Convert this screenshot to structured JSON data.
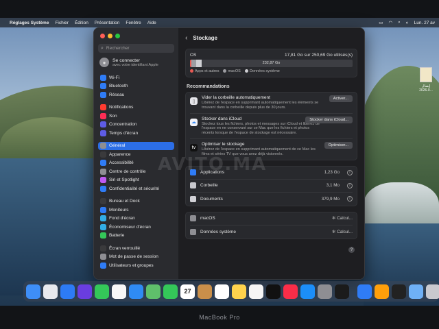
{
  "menubar": {
    "app": "Réglages Système",
    "items": [
      "Fichier",
      "Édition",
      "Présentation",
      "Fenêtre",
      "Aide"
    ],
    "datetime": "Lun. 27 av"
  },
  "desktop": {
    "file_label_1": "إيصال",
    "file_label_2": "2026-0..."
  },
  "sidebar": {
    "search_placeholder": "Rechercher",
    "account": {
      "title": "Se connecter",
      "subtitle": "avec votre identifiant Apple"
    },
    "groups": [
      [
        {
          "label": "Wi-Fi",
          "icon": "wifi-icon",
          "color": "#2f7cf6"
        },
        {
          "label": "Bluetooth",
          "icon": "bluetooth-icon",
          "color": "#2f7cf6"
        },
        {
          "label": "Réseau",
          "icon": "globe-icon",
          "color": "#2f7cf6"
        }
      ],
      [
        {
          "label": "Notifications",
          "icon": "bell-icon",
          "color": "#ff3b30"
        },
        {
          "label": "Son",
          "icon": "speaker-icon",
          "color": "#ff2d55"
        },
        {
          "label": "Concentration",
          "icon": "moon-icon",
          "color": "#5e5ce6"
        },
        {
          "label": "Temps d'écran",
          "icon": "hourglass-icon",
          "color": "#5e5ce6"
        }
      ],
      [
        {
          "label": "Général",
          "icon": "gear-icon",
          "color": "#8e8e93",
          "active": true
        },
        {
          "label": "Apparence",
          "icon": "appearance-icon",
          "color": "#3a3a3c"
        },
        {
          "label": "Accessibilité",
          "icon": "accessibility-icon",
          "color": "#2f7cf6"
        },
        {
          "label": "Centre de contrôle",
          "icon": "control-center-icon",
          "color": "#8e8e93"
        },
        {
          "label": "Siri et Spotlight",
          "icon": "siri-icon",
          "color": "#bf5af2"
        },
        {
          "label": "Confidentialité et sécurité",
          "icon": "hand-icon",
          "color": "#2f7cf6"
        }
      ],
      [
        {
          "label": "Bureau et Dock",
          "icon": "dock-icon",
          "color": "#3a3a3c"
        },
        {
          "label": "Moniteurs",
          "icon": "display-icon",
          "color": "#2f7cf6"
        },
        {
          "label": "Fond d'écran",
          "icon": "wallpaper-icon",
          "color": "#32ade6"
        },
        {
          "label": "Économiseur d'écran",
          "icon": "screensaver-icon",
          "color": "#32ade6"
        },
        {
          "label": "Batterie",
          "icon": "battery-icon",
          "color": "#34c759"
        }
      ],
      [
        {
          "label": "Écran verrouillé",
          "icon": "lock-screen-icon",
          "color": "#3a3a3c"
        },
        {
          "label": "Mot de passe de session",
          "icon": "lock-icon",
          "color": "#8e8e93"
        },
        {
          "label": "Utilisateurs et groupes",
          "icon": "users-icon",
          "color": "#2f7cf6"
        }
      ]
    ]
  },
  "content": {
    "title": "Stockage",
    "disk": {
      "name": "OS",
      "usage": "17,81 Go sur 250,69 Go utilisés(s)",
      "free": "232,87 Go",
      "used_fraction": 0.071,
      "segments": {
        "apps": 0.01,
        "macos": 0.03,
        "system": 0.031
      },
      "legend": [
        "Apps et autres",
        "macOS",
        "Données système"
      ],
      "colors": {
        "apps": "#e85a54",
        "macos": "#9d9da2",
        "system": "#cfcfd3"
      }
    },
    "recommendations_title": "Recommandations",
    "recommendations": [
      {
        "title": "Vider la corbeille automatiquement",
        "desc": "Libérez de l'espace en supprimant automatiquement les éléments se trouvant dans la corbeille depuis plus de 30 jours.",
        "button": "Activer...",
        "icon": "trash-icon"
      },
      {
        "title": "Stocker dans iCloud",
        "desc": "Stockez tous les fichiers, photos et messages sur iCloud et libérez de l'espace en ne conservant sur ce Mac que les fichiers et photos récents lorsque de l'espace de stockage est nécessaire.",
        "button": "Stocker dans iCloud...",
        "icon": "icloud-icon"
      },
      {
        "title": "Optimiser le stockage",
        "desc": "Libérez de l'espace en supprimant automatiquement de ce Mac les films et séries TV que vous avez déjà visionnés.",
        "button": "Optimiser...",
        "icon": "appletv-icon"
      }
    ],
    "categories": [
      {
        "label": "Applications",
        "value": "1,23 Go"
      },
      {
        "label": "Corbeille",
        "value": "3,1 Mo"
      },
      {
        "label": "Documents",
        "value": "379,9 Mo"
      }
    ],
    "system": [
      {
        "label": "macOS",
        "value": "Calcul..."
      },
      {
        "label": "Données système",
        "value": "Calcul..."
      }
    ]
  },
  "watermark": "AVITO.MA",
  "dock": [
    {
      "name": "finder-icon",
      "color": "#3e8ef7"
    },
    {
      "name": "launchpad-icon",
      "color": "#e9e9ee"
    },
    {
      "name": "safari-icon",
      "color": "#2d7bf5"
    },
    {
      "name": "siri-app-icon",
      "color": "#6a3de0"
    },
    {
      "name": "messages-icon",
      "color": "#34c759"
    },
    {
      "name": "photos-icon",
      "color": "#f7f7f7"
    },
    {
      "name": "mail-icon",
      "color": "#2f8bf4"
    },
    {
      "name": "maps-icon",
      "color": "#5fbf6b"
    },
    {
      "name": "facetime-icon",
      "color": "#34c759"
    },
    {
      "name": "calendar-icon",
      "color": "#ffffff"
    },
    {
      "name": "contacts-icon",
      "color": "#c98f4a"
    },
    {
      "name": "reminders-icon",
      "color": "#ffffff"
    },
    {
      "name": "notes-icon",
      "color": "#ffd34d"
    },
    {
      "name": "freeform-icon",
      "color": "#f5f5f5"
    },
    {
      "name": "appletv-app-icon",
      "color": "#111111"
    },
    {
      "name": "music-icon",
      "color": "#fa2d48"
    },
    {
      "name": "appstore-icon",
      "color": "#1c8ef9"
    },
    {
      "name": "system-settings-icon",
      "color": "#8e8e93"
    },
    {
      "name": "activity-monitor-icon",
      "color": "#1b1b1b"
    },
    {
      "name": "bluetooth-file-icon",
      "color": "#2f7cf6"
    },
    {
      "name": "books-icon",
      "color": "#ff9f0a"
    },
    {
      "name": "piano-icon",
      "color": "#222222"
    },
    {
      "name": "downloads-icon",
      "color": "#6fb0f5"
    },
    {
      "name": "dock-trash-icon",
      "color": "#c9c9ce"
    }
  ],
  "device_label": "MacBook Pro",
  "calendar_day": "27"
}
